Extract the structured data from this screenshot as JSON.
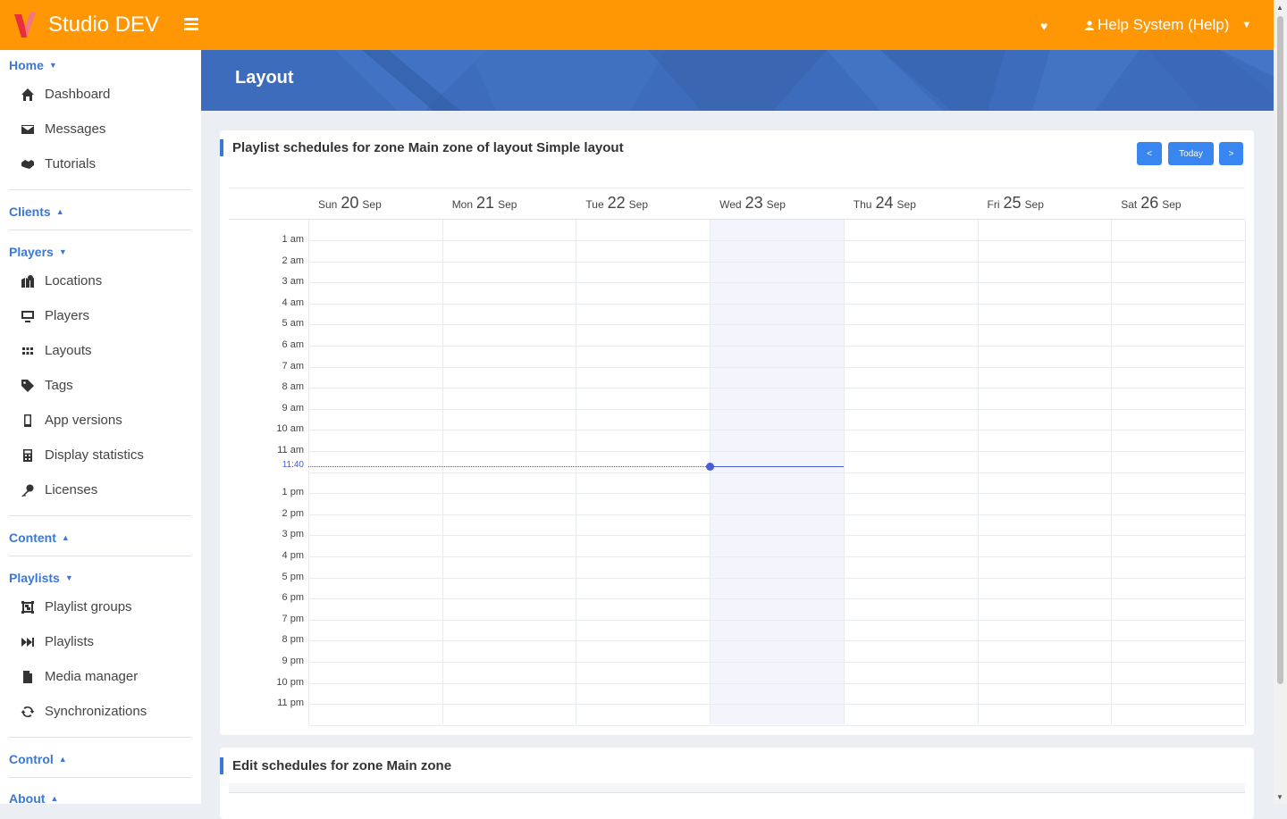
{
  "app": {
    "title": "Studio DEV",
    "user": "Help System (Help)"
  },
  "banner": {
    "title": "Layout"
  },
  "sidebar": {
    "sections": [
      {
        "label": "Home",
        "expanded": true,
        "items": [
          {
            "label": "Dashboard",
            "icon": "home-icon"
          },
          {
            "label": "Messages",
            "icon": "envelope-icon"
          },
          {
            "label": "Tutorials",
            "icon": "handshake-icon"
          }
        ]
      },
      {
        "label": "Clients",
        "expanded": false,
        "items": []
      },
      {
        "label": "Players",
        "expanded": true,
        "items": [
          {
            "label": "Locations",
            "icon": "map-pin-icon"
          },
          {
            "label": "Players",
            "icon": "monitor-icon"
          },
          {
            "label": "Layouts",
            "icon": "grid-icon"
          },
          {
            "label": "Tags",
            "icon": "tag-icon"
          },
          {
            "label": "App versions",
            "icon": "mobile-icon"
          },
          {
            "label": "Display statistics",
            "icon": "calculator-icon"
          },
          {
            "label": "Licenses",
            "icon": "key-icon"
          }
        ]
      },
      {
        "label": "Content",
        "expanded": false,
        "items": []
      },
      {
        "label": "Playlists",
        "expanded": true,
        "items": [
          {
            "label": "Playlist groups",
            "icon": "object-group-icon"
          },
          {
            "label": "Playlists",
            "icon": "fast-forward-icon"
          },
          {
            "label": "Media manager",
            "icon": "file-icon"
          },
          {
            "label": "Synchronizations",
            "icon": "sync-icon"
          }
        ]
      },
      {
        "label": "Control",
        "expanded": false,
        "items": []
      },
      {
        "label": "About",
        "expanded": false,
        "items": []
      }
    ]
  },
  "schedule_card": {
    "title": "Playlist schedules for zone Main zone of layout Simple layout",
    "buttons": {
      "prev": "<",
      "today": "Today",
      "next": ">"
    },
    "days": [
      {
        "dow": "Sun",
        "num": "20",
        "mon": "Sep"
      },
      {
        "dow": "Mon",
        "num": "21",
        "mon": "Sep"
      },
      {
        "dow": "Tue",
        "num": "22",
        "mon": "Sep"
      },
      {
        "dow": "Wed",
        "num": "23",
        "mon": "Sep",
        "today": true
      },
      {
        "dow": "Thu",
        "num": "24",
        "mon": "Sep"
      },
      {
        "dow": "Fri",
        "num": "25",
        "mon": "Sep"
      },
      {
        "dow": "Sat",
        "num": "26",
        "mon": "Sep"
      }
    ],
    "hours": [
      "1 am",
      "2 am",
      "3 am",
      "4 am",
      "5 am",
      "6 am",
      "7 am",
      "8 am",
      "9 am",
      "10 am",
      "11 am",
      "",
      "1 pm",
      "2 pm",
      "3 pm",
      "4 pm",
      "5 pm",
      "6 pm",
      "7 pm",
      "8 pm",
      "9 pm",
      "10 pm",
      "11 pm"
    ],
    "now_label": "11:40"
  },
  "edit_card": {
    "title": "Edit schedules for zone Main zone"
  },
  "colors": {
    "topbar": "#ff9705",
    "accent": "#3a78d8",
    "banner": "#3d6cbc",
    "now": "#4a5ad8",
    "today_bg": "#f4f4fd"
  }
}
